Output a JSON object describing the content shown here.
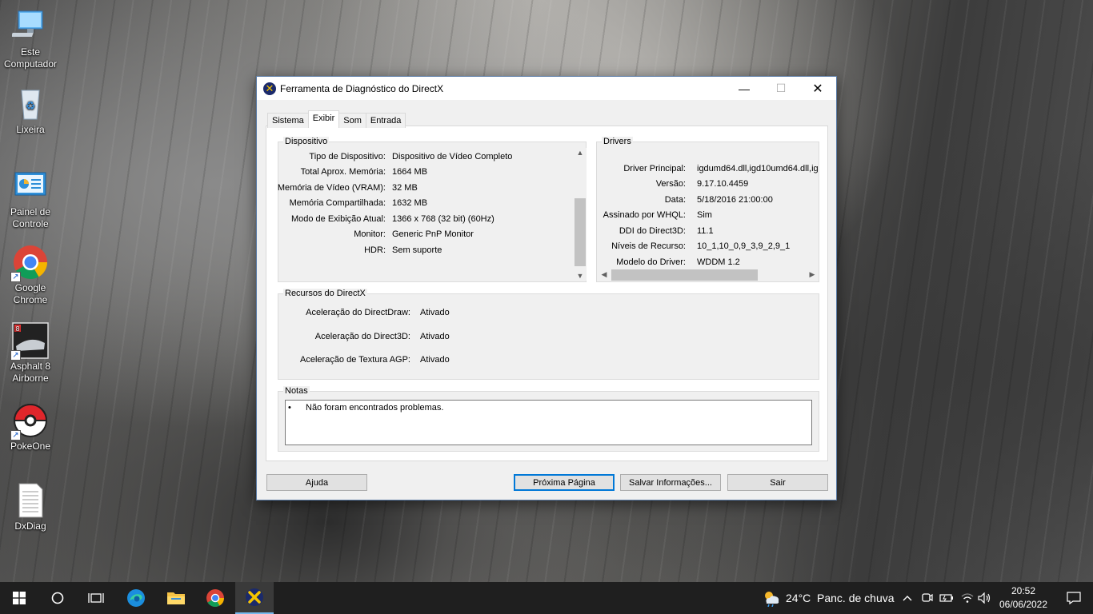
{
  "desktop": {
    "icons": [
      {
        "label": "Este Computador"
      },
      {
        "label": "Lixeira"
      },
      {
        "label": "Painel de Controle"
      },
      {
        "label": "Google Chrome"
      },
      {
        "label": "Asphalt 8 Airborne"
      },
      {
        "label": "PokeOne"
      },
      {
        "label": "DxDiag"
      }
    ]
  },
  "window": {
    "title": "Ferramenta de Diagnóstico do DirectX",
    "tabs": [
      "Sistema",
      "Exibir",
      "Som",
      "Entrada"
    ],
    "active_tab": "Exibir",
    "device": {
      "title": "Dispositivo",
      "rows": [
        {
          "key": "Tipo de Dispositivo:",
          "value": "Dispositivo de Vídeo Completo"
        },
        {
          "key": "Total Aprox. Memória:",
          "value": "1664 MB"
        },
        {
          "key": "Memória de Vídeo (VRAM):",
          "value": "32 MB"
        },
        {
          "key": "Memória Compartilhada:",
          "value": "1632 MB"
        },
        {
          "key": "Modo de Exibição Atual:",
          "value": "1366 x 768 (32 bit) (60Hz)"
        },
        {
          "key": "Monitor:",
          "value": "Generic PnP Monitor"
        },
        {
          "key": "HDR:",
          "value": "Sem suporte"
        }
      ]
    },
    "drivers": {
      "title": "Drivers",
      "rows": [
        {
          "key": "Driver Principal:",
          "value": "igdumd64.dll,igd10umd64.dll,igd"
        },
        {
          "key": "Versão:",
          "value": "9.17.10.4459"
        },
        {
          "key": "Data:",
          "value": "5/18/2016 21:00:00"
        },
        {
          "key": "Assinado por WHQL:",
          "value": "Sim"
        },
        {
          "key": "DDI do Direct3D:",
          "value": "11.1"
        },
        {
          "key": "Níveis de Recurso:",
          "value": "10_1,10_0,9_3,9_2,9_1"
        },
        {
          "key": "Modelo do Driver:",
          "value": "WDDM 1.2"
        }
      ]
    },
    "features": {
      "title": "Recursos do DirectX",
      "rows": [
        {
          "key": "Aceleração do DirectDraw:",
          "value": "Ativado"
        },
        {
          "key": "Aceleração do Direct3D:",
          "value": "Ativado"
        },
        {
          "key": "Aceleração de Textura AGP:",
          "value": "Ativado"
        }
      ]
    },
    "notes": {
      "title": "Notas",
      "bullet": "•",
      "text": "Não foram encontrados problemas."
    },
    "buttons": {
      "help": "Ajuda",
      "next": "Próxima Página",
      "save": "Salvar Informações...",
      "exit": "Sair"
    }
  },
  "taskbar": {
    "weather_temp": "24°C",
    "weather_desc": "Panc. de chuva",
    "time": "20:52",
    "date": "06/06/2022"
  }
}
